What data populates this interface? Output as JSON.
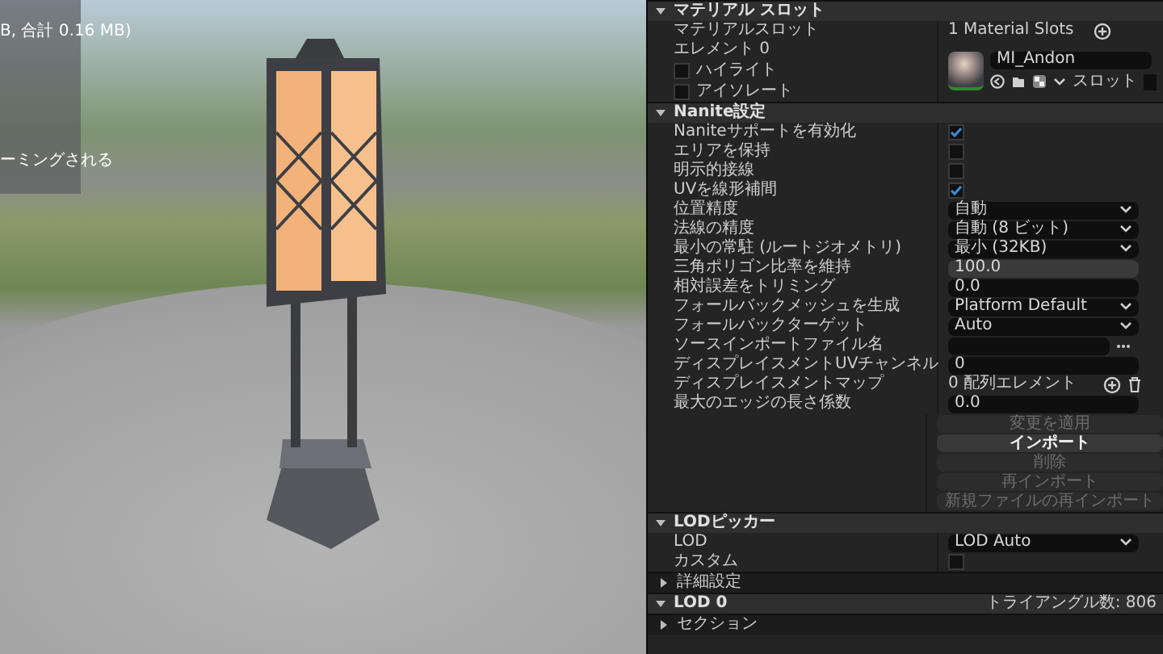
{
  "viewport": {
    "info_lines": [
      "B, 合計 0.16 MB)",
      "ーミングされる"
    ]
  },
  "sections": [
    {
      "title": "マテリアル スロット",
      "expanded": true,
      "rows": [
        {
          "kind": "slots",
          "label": "マテリアルスロット",
          "value": "1 Material Slots"
        },
        {
          "kind": "element",
          "label": "エレメント 0",
          "options": [
            {
              "label": "ハイライト",
              "checked": false
            },
            {
              "label": "アイソレート",
              "checked": false
            }
          ],
          "material": "MI_Andon",
          "slot_label": "スロット"
        }
      ]
    },
    {
      "title": "Nanite設定",
      "expanded": true,
      "rows": [
        {
          "kind": "check",
          "label": "Naniteサポートを有効化",
          "checked": true
        },
        {
          "kind": "check",
          "label": "エリアを保持",
          "checked": false
        },
        {
          "kind": "check",
          "label": "明示的接線",
          "checked": false
        },
        {
          "kind": "check",
          "label": "UVを線形補間",
          "checked": true
        },
        {
          "kind": "dropdown",
          "label": "位置精度",
          "value": "自動"
        },
        {
          "kind": "dropdown",
          "label": "法線の精度",
          "value": "自動 (8 ビット)"
        },
        {
          "kind": "dropdown",
          "label": "最小の常駐 (ルートジオメトリ)",
          "value": "最小 (32KB)"
        },
        {
          "kind": "spinbox",
          "label": "三角ポリゴン比率を維持",
          "value": "100.0"
        },
        {
          "kind": "number",
          "label": "相対誤差をトリミング",
          "value": "0.0"
        },
        {
          "kind": "dropdown",
          "label": "フォールバックメッシュを生成",
          "value": "Platform Default"
        },
        {
          "kind": "dropdown",
          "label": "フォールバックターゲット",
          "value": "Auto"
        },
        {
          "kind": "file",
          "label": "ソースインポートファイル名"
        },
        {
          "kind": "number",
          "label": "ディスプレイスメントUVチャンネル",
          "value": "0"
        },
        {
          "kind": "array",
          "label": "ディスプレイスメントマップ",
          "value": "0 配列エレメント"
        },
        {
          "kind": "number",
          "label": "最大のエッジの長さ係数",
          "value": "0.0"
        },
        {
          "kind": "buttons",
          "buttons": [
            {
              "label": "変更を適用",
              "disabled": true
            },
            {
              "label": "インポート",
              "disabled": false
            },
            {
              "label": "削除",
              "disabled": true
            },
            {
              "label": "再インポート",
              "disabled": true
            },
            {
              "label": "新規ファイルの再インポート",
              "disabled": true
            }
          ]
        }
      ]
    },
    {
      "title": "LODピッカー",
      "expanded": true,
      "rows": [
        {
          "kind": "dropdown",
          "label": "LOD",
          "value": "LOD Auto"
        },
        {
          "kind": "check",
          "label": "カスタム",
          "checked": false
        },
        {
          "kind": "group",
          "label": "詳細設定",
          "expanded": false
        }
      ]
    },
    {
      "title": "LOD 0",
      "expanded": true,
      "info": "トライアングル数: 806",
      "rows": [
        {
          "kind": "group",
          "label": "セクション",
          "expanded": false
        }
      ]
    }
  ]
}
